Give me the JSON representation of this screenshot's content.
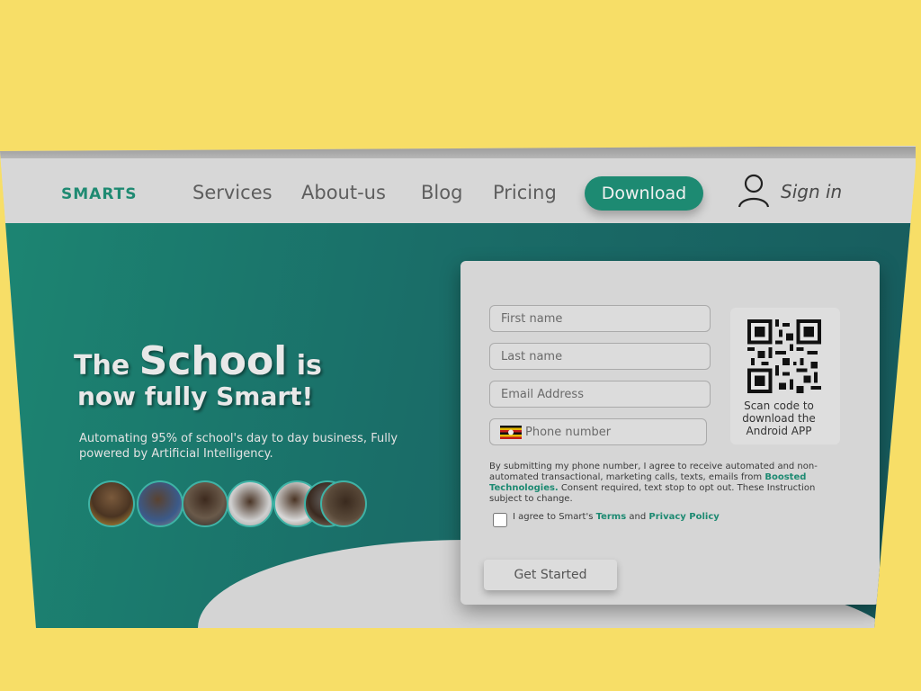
{
  "header": {
    "brand": "SMARTS",
    "nav": [
      {
        "label": "Services"
      },
      {
        "label": "About-us"
      },
      {
        "label": "Blog"
      },
      {
        "label": "Pricing"
      }
    ],
    "download_label": "Download",
    "signin_label": "Sign in"
  },
  "hero": {
    "headline_the": "The",
    "headline_school": "School",
    "headline_is": "is",
    "headline_line2": "now fully Smart!",
    "subtext": "Automating 95% of school's day to day business, Fully powered by Artificial Intelligency."
  },
  "form": {
    "first_name_placeholder": "First name",
    "last_name_placeholder": "Last name",
    "email_placeholder": "Email Address",
    "phone_placeholder": "Phone number",
    "qr_caption": "Scan code to download the Android APP",
    "consent_before": "By submitting my phone number, I agree to receive automated and non-automated transactional, marketing calls, texts, emails from",
    "consent_company": "Boosted Technologies.",
    "consent_after": "Consent required, text stop to opt out. These Instruction subject to change.",
    "agree_prefix": "I agree to Smart's",
    "terms": "Terms",
    "and": "and",
    "privacy": "Privacy Policy",
    "submit_label": "Get Started"
  },
  "colors": {
    "accent": "#1d8a72",
    "hero_dark": "#175b5d",
    "background": "#f7de67"
  },
  "icons": [
    "user-icon",
    "uganda-flag-icon",
    "qr-code"
  ]
}
